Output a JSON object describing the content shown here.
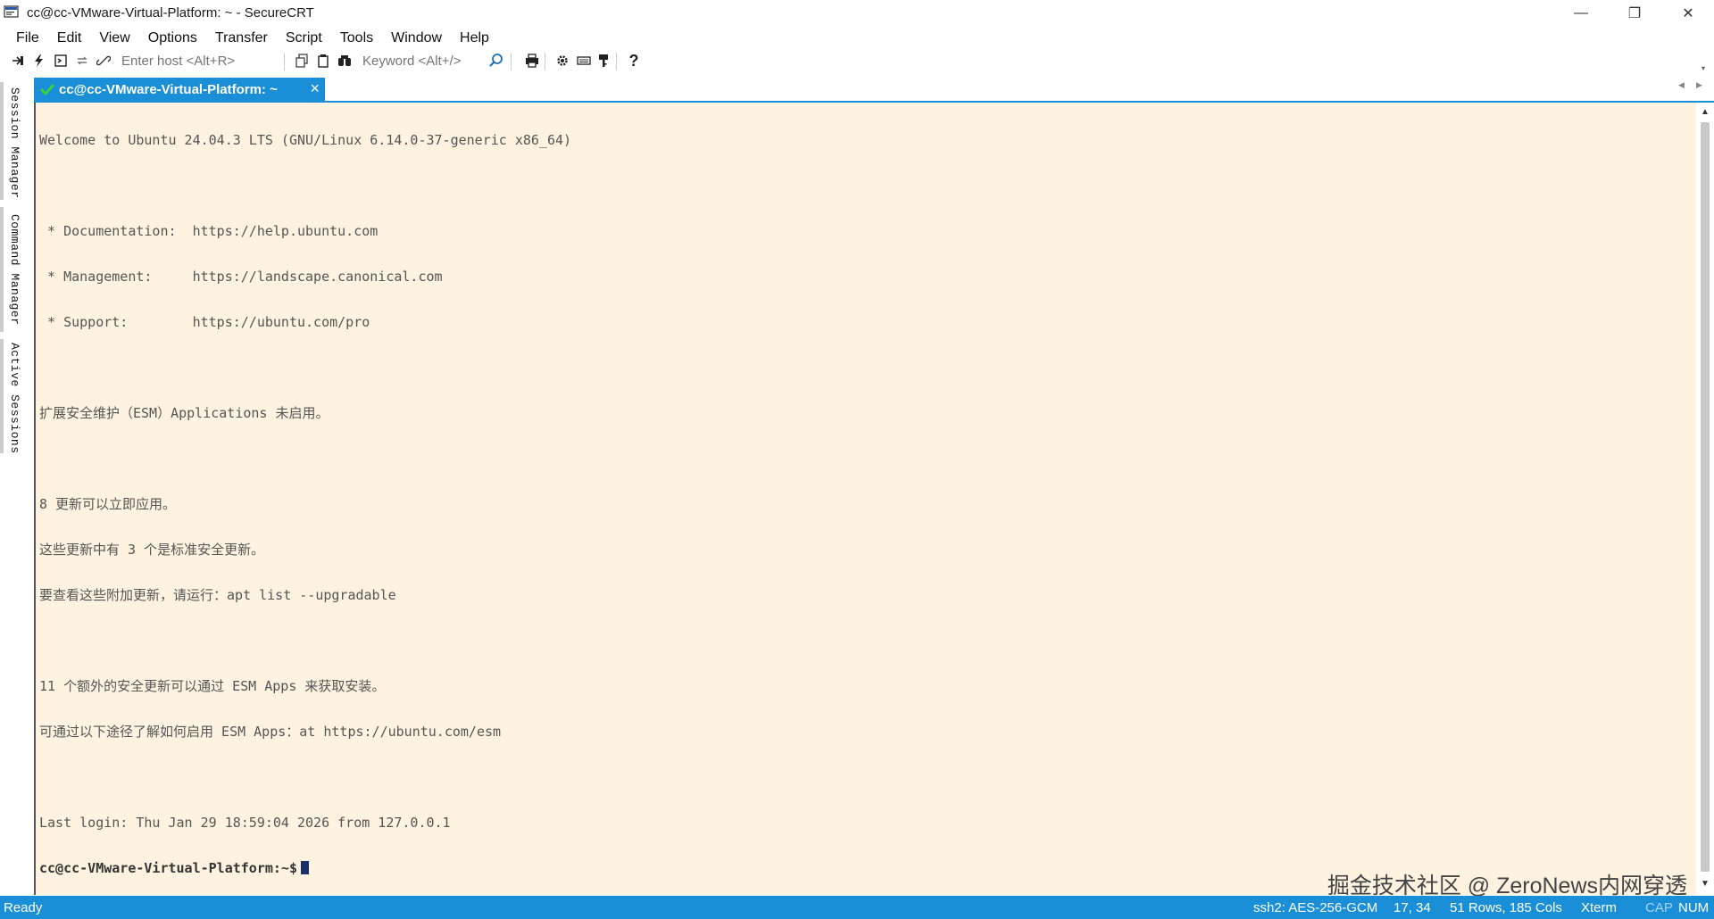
{
  "window": {
    "title": "cc@cc-VMware-Virtual-Platform: ~ - SecureCRT",
    "minimize_glyph": "—",
    "restore_glyph": "❐",
    "close_glyph": "✕"
  },
  "menu": [
    "File",
    "Edit",
    "View",
    "Options",
    "Transfer",
    "Script",
    "Tools",
    "Window",
    "Help"
  ],
  "toolbar": {
    "host_placeholder": "Enter host <Alt+R>",
    "keyword_placeholder": "Keyword <Alt+/>",
    "icons": [
      "connect-icon",
      "quick-connect-icon",
      "connect-tab-icon",
      "reconnect-icon",
      "disconnect-icon",
      "copy-icon",
      "paste-icon",
      "find-icon",
      "search-icon",
      "print-icon",
      "settings-icon",
      "keymap-icon",
      "keygen-icon",
      "help-icon"
    ]
  },
  "side_tabs": [
    "Session Manager",
    "Command Manager",
    "Active Sessions"
  ],
  "session_tab": {
    "label": "cc@cc-VMware-Virtual-Platform: ~",
    "close": "×",
    "status_color": "#39d23b"
  },
  "terminal": {
    "lines": [
      "Welcome to Ubuntu 24.04.3 LTS (GNU/Linux 6.14.0-37-generic x86_64)",
      "",
      " * Documentation:  https://help.ubuntu.com",
      " * Management:     https://landscape.canonical.com",
      " * Support:        https://ubuntu.com/pro",
      "",
      "扩展安全维护（ESM）Applications 未启用。",
      "",
      "8 更新可以立即应用。",
      "这些更新中有 3 个是标准安全更新。",
      "要查看这些附加更新，请运行：apt list --upgradable",
      "",
      "11 个额外的安全更新可以通过 ESM Apps 来获取安装。",
      "可通过以下途径了解如何启用 ESM Apps：at https://ubuntu.com/esm",
      "",
      "Last login: Thu Jan 29 18:59:04 2026 from 127.0.0.1"
    ],
    "prompt": "cc@cc-VMware-Virtual-Platform:~$"
  },
  "watermark": "掘金技术社区 @ ZeroNews内网穿透",
  "status": {
    "ready": "Ready",
    "cipher": "ssh2: AES-256-GCM",
    "cursor_pos": "17, 34",
    "size": "51 Rows, 185 Cols",
    "term_type": "Xterm",
    "cap": "CAP",
    "num": "NUM"
  },
  "colors": {
    "accent": "#1a8fd8",
    "terminal_bg": "#fdf3e0"
  }
}
